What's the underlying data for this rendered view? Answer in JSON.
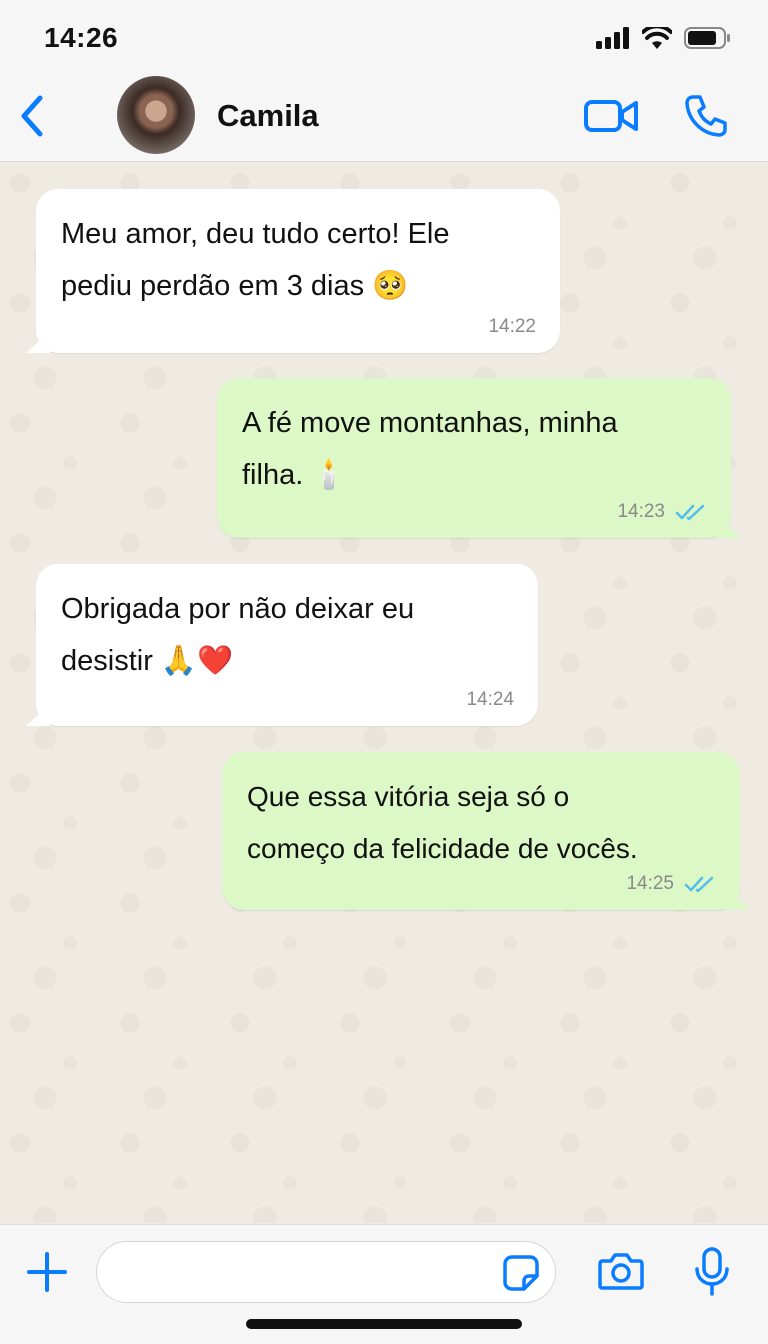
{
  "status_bar": {
    "time": "14:26"
  },
  "header": {
    "contact_name": "Camila"
  },
  "messages": [
    {
      "direction": "in",
      "text_line1": "Meu amor, deu tudo certo! Ele",
      "text_line2": "pediu perdão em 3 dias 🥺",
      "time": "14:22"
    },
    {
      "direction": "out",
      "text_line1": "A fé move montanhas, minha",
      "text_line2": "filha. 🕯️",
      "time": "14:23",
      "status": "read"
    },
    {
      "direction": "in",
      "text_line1": "Obrigada por não deixar eu",
      "text_line2": "desistir 🙏❤️",
      "time": "14:24"
    },
    {
      "direction": "out",
      "text_line1": "Que essa vitória seja só o",
      "text_line2": "começo da felicidade de vocês.",
      "time": "14:25",
      "status": "read"
    }
  ],
  "input": {
    "value": "",
    "placeholder": ""
  },
  "icons": {
    "back": "chevron-left-icon",
    "video": "video-camera-icon",
    "phone": "phone-icon",
    "plus": "plus-icon",
    "sticker": "sticker-icon",
    "camera": "camera-icon",
    "mic": "microphone-icon",
    "read_ticks": "double-check-icon"
  },
  "colors": {
    "accent": "#0a7cff",
    "incoming_bubble": "#ffffff",
    "outgoing_bubble": "#dcf8c6",
    "chat_background": "#efeae2",
    "read_ticks": "#53bdeb"
  }
}
